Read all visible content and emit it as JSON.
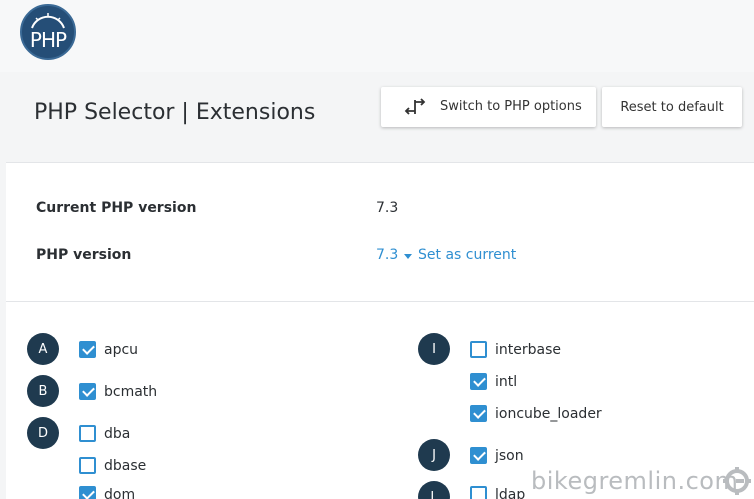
{
  "header": {
    "logo_text": "PHP",
    "page_title": "PHP Selector | Extensions"
  },
  "toolbar": {
    "switch_label": "Switch to PHP options",
    "reset_label": "Reset to default"
  },
  "version_info": {
    "current_label": "Current PHP version",
    "current_value": "7.3",
    "php_version_label": "PHP version",
    "php_version_value": "7.3",
    "set_as_current": "Set as current"
  },
  "groups": {
    "A": {
      "letter": "A",
      "items": [
        {
          "name": "apcu",
          "checked": true
        }
      ]
    },
    "B": {
      "letter": "B",
      "items": [
        {
          "name": "bcmath",
          "checked": true
        }
      ]
    },
    "D": {
      "letter": "D",
      "items": [
        {
          "name": "dba",
          "checked": false
        },
        {
          "name": "dbase",
          "checked": false
        },
        {
          "name": "dom",
          "checked": true
        }
      ]
    },
    "I": {
      "letter": "I",
      "items": [
        {
          "name": "interbase",
          "checked": false
        },
        {
          "name": "intl",
          "checked": true
        },
        {
          "name": "ioncube_loader",
          "checked": true
        }
      ]
    },
    "J": {
      "letter": "J",
      "items": [
        {
          "name": "json",
          "checked": true
        }
      ]
    },
    "L": {
      "letter": "L",
      "items": [
        {
          "name": "ldap",
          "checked": false
        }
      ]
    }
  },
  "watermark": "bikegremlin.com",
  "colors": {
    "accent": "#2f8fd1",
    "letter_badge": "#1f3a4f",
    "logo_bg": "#254e77"
  }
}
